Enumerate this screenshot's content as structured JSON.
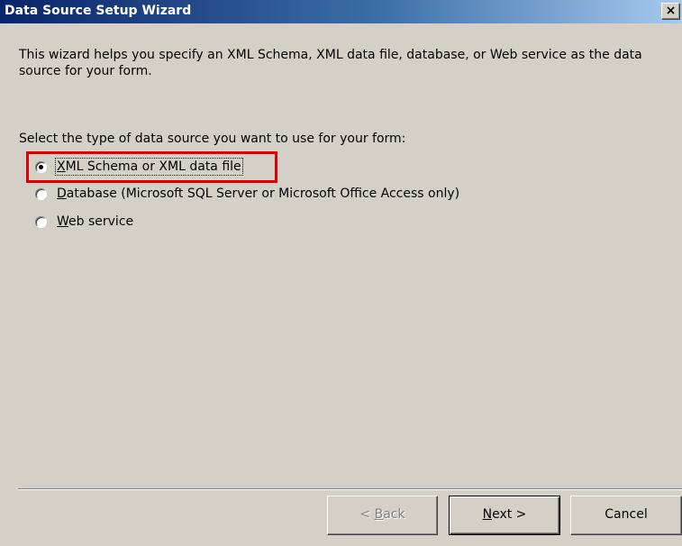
{
  "window": {
    "title": "Data Source Setup Wizard",
    "close_glyph": "×",
    "close_icon": "close-icon"
  },
  "intro": {
    "text": "This wizard helps you specify an XML Schema, XML data file, database, or Web service as the data source for your form."
  },
  "prompt": {
    "text": "Select the type of data source you want to use for your form:"
  },
  "options": [
    {
      "mnemonic": "X",
      "rest": "ML Schema or XML data file",
      "selected": true
    },
    {
      "mnemonic": "D",
      "rest": "atabase (Microsoft SQL Server or Microsoft Office Access only)",
      "selected": false
    },
    {
      "mnemonic": "W",
      "rest": "eb service",
      "selected": false
    }
  ],
  "buttons": {
    "back": {
      "prefix": "< ",
      "mnemonic": "B",
      "rest": "ack",
      "enabled": false
    },
    "next": {
      "mnemonic": "N",
      "rest": "ext >",
      "enabled": true
    },
    "cancel": {
      "label": "Cancel",
      "enabled": true
    }
  },
  "colors": {
    "titlebar_start": "#0a246a",
    "titlebar_end": "#a6caf0",
    "dialog_face": "#d4d0c8",
    "highlight_box": "#e00000"
  }
}
